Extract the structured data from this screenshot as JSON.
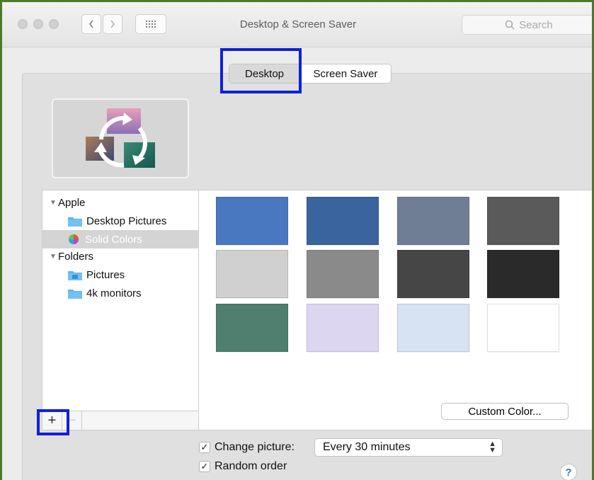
{
  "window": {
    "title": "Desktop & Screen Saver",
    "search_placeholder": "Search"
  },
  "tabs": [
    {
      "label": "Desktop",
      "active": true
    },
    {
      "label": "Screen Saver",
      "active": false
    }
  ],
  "sidebar": {
    "groups": [
      {
        "label": "Apple",
        "items": [
          {
            "label": "Desktop Pictures",
            "icon": "folder-icon"
          },
          {
            "label": "Solid Colors",
            "icon": "color-wheel-icon",
            "selected": true
          }
        ]
      },
      {
        "label": "Folders",
        "items": [
          {
            "label": "Pictures",
            "icon": "pictures-folder-icon"
          },
          {
            "label": "4k monitors",
            "icon": "folder-icon"
          }
        ]
      }
    ],
    "footer": {
      "add_label": "+",
      "remove_label": "−"
    }
  },
  "swatches": [
    "#4a78c0",
    "#3a649e",
    "#6f7d95",
    "#5a5a5a",
    "#d0d0d0",
    "#8a8a8a",
    "#464646",
    "#2a2a2a",
    "#4f7f6e",
    "#ddd6f0",
    "#d7e2f2",
    "#ffffff"
  ],
  "custom_color_label": "Custom Color...",
  "options": {
    "change_picture": {
      "label": "Change picture:",
      "checked": true,
      "check_glyph": "✓"
    },
    "interval": {
      "value": "Every 30 minutes"
    },
    "random_order": {
      "label": "Random order",
      "checked": true,
      "check_glyph": "✓"
    }
  },
  "help_label": "?",
  "colors": {
    "frame_border": "#4b7a2c",
    "highlight": "#1020d6"
  }
}
